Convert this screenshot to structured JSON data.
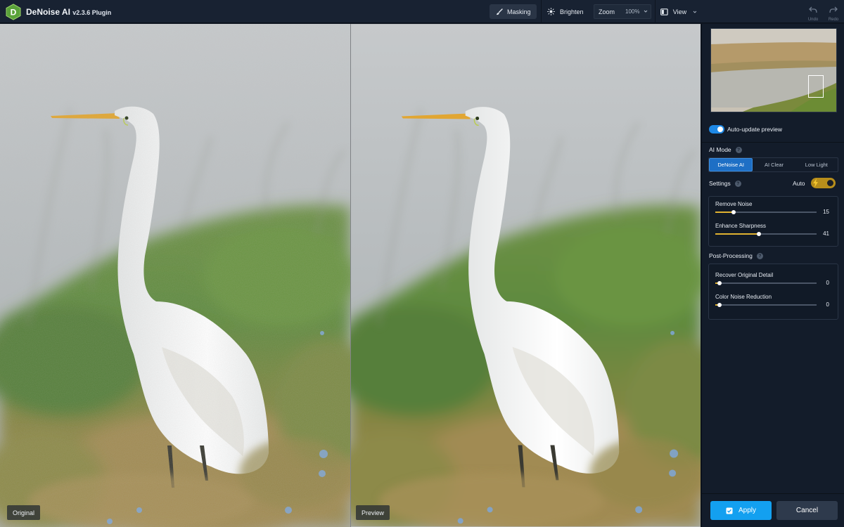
{
  "app": {
    "name": "DeNoise AI",
    "version": "v2.3.6 Plugin",
    "logo_letter": "D"
  },
  "toolbar": {
    "masking_label": "Masking",
    "brighten_label": "Brighten",
    "zoom_label": "Zoom",
    "zoom_value": "100%",
    "view_label": "View",
    "undo_label": "Undo",
    "redo_label": "Redo"
  },
  "canvas": {
    "left_label": "Original",
    "right_label": "Preview"
  },
  "panel": {
    "auto_update_label": "Auto-update preview",
    "auto_update_on": true,
    "ai_mode": {
      "title": "AI Mode",
      "modes": [
        {
          "label": "DeNoise AI",
          "active": true
        },
        {
          "label": "AI Clear",
          "active": false
        },
        {
          "label": "Low Light",
          "active": false
        }
      ]
    },
    "settings": {
      "title": "Settings",
      "auto_label": "Auto",
      "auto_on": true,
      "sliders": [
        {
          "label": "Remove Noise",
          "value": 15,
          "max": 100
        },
        {
          "label": "Enhance Sharpness",
          "value": 41,
          "max": 100
        }
      ]
    },
    "post_processing": {
      "title": "Post-Processing",
      "sliders": [
        {
          "label": "Recover Original Detail",
          "value": 0,
          "max": 100
        },
        {
          "label": "Color Noise Reduction",
          "value": 0,
          "max": 100
        }
      ]
    },
    "apply_label": "Apply",
    "cancel_label": "Cancel"
  },
  "colors": {
    "accent": "#1e88e5",
    "apply": "#13a0f0",
    "slider_fill": "#e0b230",
    "auto_toggle": "#b78e1b"
  },
  "icons": [
    "logo-icon",
    "brush-icon",
    "sun-icon",
    "chevron-down-icon",
    "view-split-icon",
    "undo-icon",
    "redo-icon",
    "help-icon",
    "bolt-icon",
    "apply-icon"
  ]
}
